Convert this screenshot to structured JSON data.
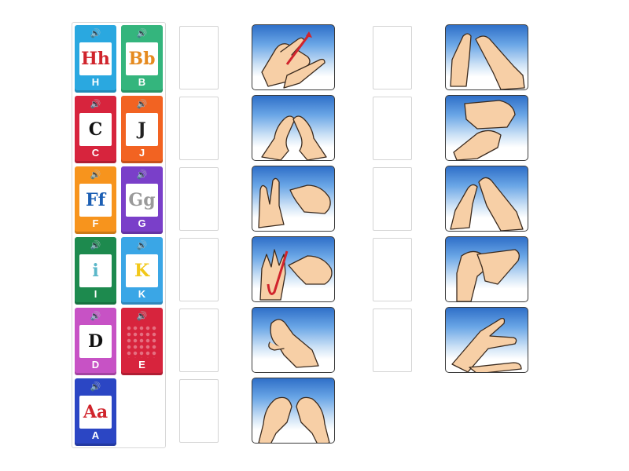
{
  "speaker_glyph": "🔊",
  "tiles": [
    {
      "letter": "H",
      "card_text": "Hh",
      "color": "#2aa8e0",
      "card_color": "#d0242c"
    },
    {
      "letter": "B",
      "card_text": "Bb",
      "color": "#34b57d",
      "card_color": "#e58a1f"
    },
    {
      "letter": "C",
      "card_text": "C",
      "color": "#d7243d",
      "card_color": "#111111"
    },
    {
      "letter": "J",
      "card_text": "J",
      "color": "#f26322",
      "card_color": "#222222"
    },
    {
      "letter": "F",
      "card_text": "Ff",
      "color": "#f7941d",
      "card_color": "#1c5fb4"
    },
    {
      "letter": "G",
      "card_text": "Gg",
      "color": "#7a3fc9",
      "card_color": "#9a9a9a"
    },
    {
      "letter": "I",
      "card_text": "i",
      "color": "#1d8a4e",
      "card_color": "#5bb7c9"
    },
    {
      "letter": "K",
      "card_text": "K",
      "color": "#3aa6e6",
      "card_color": "#f2c81a"
    },
    {
      "letter": "D",
      "card_text": "D",
      "color": "#c752c5",
      "card_color": "#111111"
    },
    {
      "letter": "E",
      "card_text": "",
      "color": "#d7243d",
      "card_color": "#d7243d"
    },
    {
      "letter": "A",
      "card_text": "Aa",
      "color": "#2b46c4",
      "card_color": "#d0242c"
    }
  ],
  "drop_zones_left_count": 6,
  "drop_zones_right_count": 5,
  "sign_images_left_count": 6,
  "sign_images_right_count": 5,
  "colors": {
    "sky_top": "#2f6fc8",
    "hand_fill": "#f7cfa6",
    "hand_stroke": "#3a2a1e",
    "arrow": "#d0242c"
  }
}
